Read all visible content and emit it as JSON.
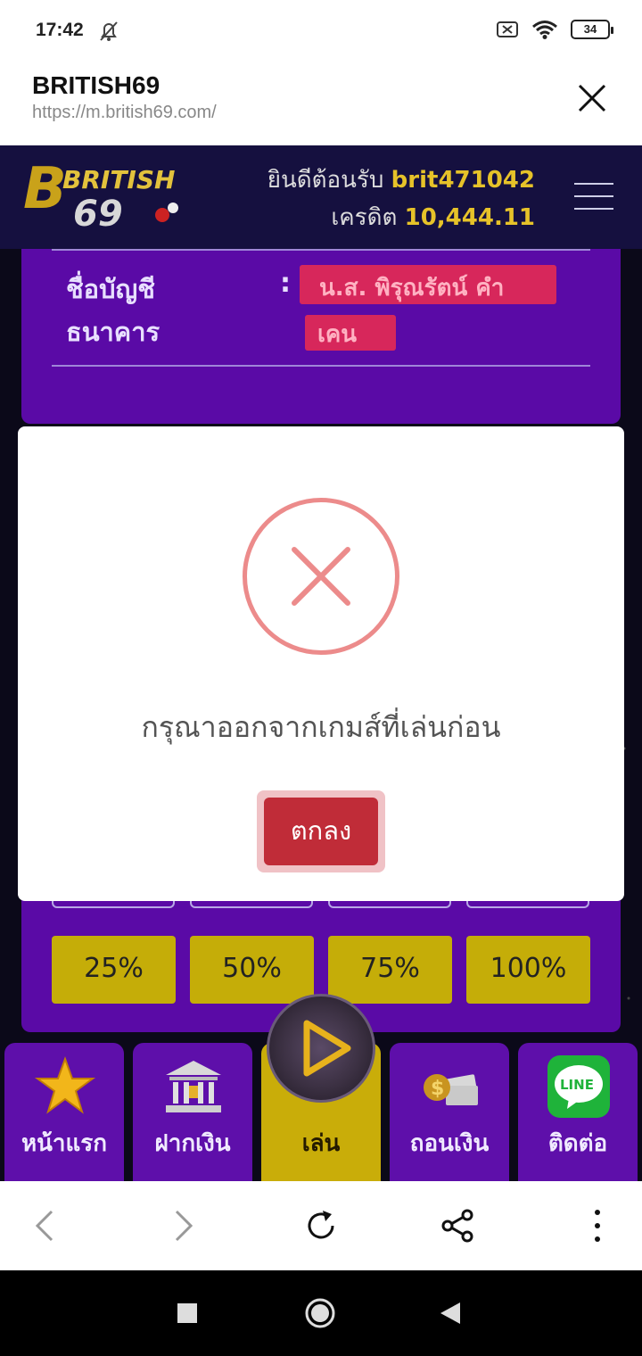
{
  "status_bar": {
    "time": "17:42",
    "battery": "34"
  },
  "browser": {
    "title": "BRITISH69",
    "url": "https://m.british69.com/"
  },
  "site": {
    "logo_text_top": "BRITISH",
    "logo_text_bottom": "69",
    "welcome_prefix": "ยินดีต้อนรับ",
    "username": "brit471042",
    "credit_prefix": "เครดิต",
    "credit": "10,444.11"
  },
  "account": {
    "label_line1": "ชื่อบัญชี",
    "label_line2": "ธนาคาร",
    "colon": ":",
    "name_line1": "น.ส. พิรุณรัตน์ คำ",
    "name_line2": "เคน"
  },
  "percent_buttons": [
    "25%",
    "50%",
    "75%",
    "100%"
  ],
  "bottom_nav": [
    {
      "label": "หน้าแรก",
      "icon": "star-icon"
    },
    {
      "label": "ฝากเงิน",
      "icon": "bank-icon"
    },
    {
      "label": "เล่น",
      "icon": "play-icon"
    },
    {
      "label": "ถอนเงิน",
      "icon": "money-icon"
    },
    {
      "label": "ติดต่อ",
      "icon": "line-icon"
    }
  ],
  "line_badge": "LINE",
  "modal": {
    "message": "กรุณาออกจากเกมส์ที่เล่นก่อน",
    "ok_label": "ตกลง"
  },
  "colors": {
    "accent_gold": "#e6c229",
    "panel_purple": "#5a0aa6",
    "error_red": "#ec8b8b",
    "ok_button": "#c02c38"
  }
}
